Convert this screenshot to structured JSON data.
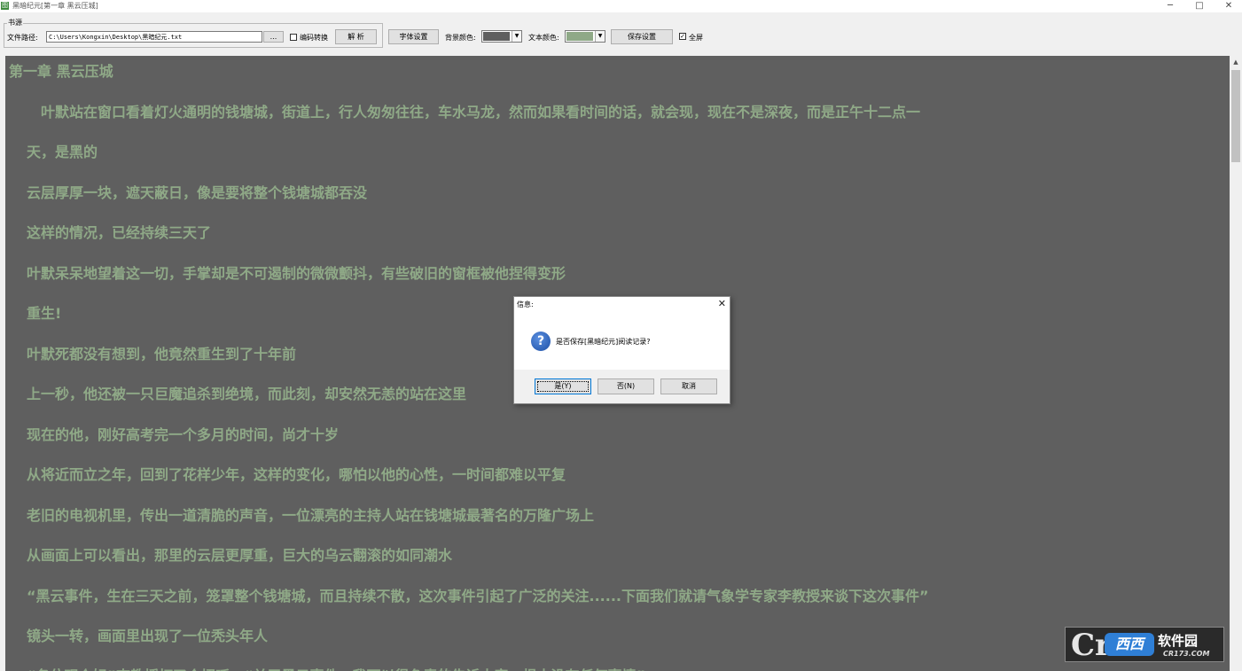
{
  "window": {
    "title": "黑暗纪元[第一章 黑云压城]",
    "app_icon": "图",
    "controls": {
      "minimize": "─",
      "maximize": "□",
      "close": "✕"
    }
  },
  "toolbar": {
    "group_title": "书源",
    "file_path_label": "文件路径:",
    "file_path_value": "C:\\Users\\Kongxin\\Desktop\\黑暗纪元.txt",
    "browse_button": "...",
    "encoding_label": "编码转换",
    "encoding_checked": false,
    "parse_button": "解 析",
    "font_button": "字体设置",
    "bg_color_label": "背景颜色:",
    "bg_color": "#5f5f5f",
    "text_color_label": "文本颜色:",
    "text_color": "#8fa987",
    "save_settings_button": "保存设置",
    "fullscreen_label": "全屏",
    "fullscreen_checked": true,
    "checkmark": "✓",
    "dropdown_arrow": "▼"
  },
  "reader": {
    "chapter_title": "第一章 黑云压城",
    "paragraphs": [
      "　叶默站在窗口看着灯火通明的钱塘城，街道上，行人匆匆往往，车水马龙，然而如果看时间的话，就会现，现在不是深夜，而是正午十二点一",
      "天，是黑的",
      "云层厚厚一块，遮天蔽日，像是要将整个钱塘城都吞没",
      "这样的情况，已经持续三天了",
      "叶默呆呆地望着这一切，手掌却是不可遏制的微微颤抖，有些破旧的窗框被他捏得变形",
      "重生!",
      "叶默死都没有想到，他竟然重生到了十年前",
      "上一秒，他还被一只巨魔追杀到绝境，而此刻，却安然无恙的站在这里",
      "现在的他，刚好高考完一个多月的时间，尚才十岁",
      "从将近而立之年，回到了花样少年，这样的变化，哪怕以他的心性，一时间都难以平复",
      "老旧的电视机里，传出一道清脆的声音，一位漂亮的主持人站在钱塘城最著名的万隆广场上",
      "从画面上可以看出，那里的云层更厚重，巨大的乌云翻滚的如同潮水",
      "“黑云事件，生在三天之前，笼罩整个钱塘城，而且持续不散，这次事件引起了广泛的关注......下面我们就请气象学专家李教授来谈下这次事件”",
      "镜头一转，画面里出现了一位秃头年人",
      "“各位观众好”李教授打了个招呼，“关于黑云事件，我可以很负责的告诉大家，根本没有任何事情”"
    ]
  },
  "scrollbar": {
    "up_arrow": "▲",
    "position_fraction": 0.0
  },
  "dialog": {
    "title": "信息:",
    "close": "✕",
    "icon": "question-icon",
    "icon_glyph": "?",
    "message": "是否保存[黑暗纪元]阅读记录?",
    "yes_button": "是(Y)",
    "no_button": "否(N)",
    "cancel_button": "取消"
  },
  "watermark": {
    "c_glyph": "Cr",
    "brand": "西西",
    "suffix": "软件园",
    "domain": "CR173.COM"
  }
}
